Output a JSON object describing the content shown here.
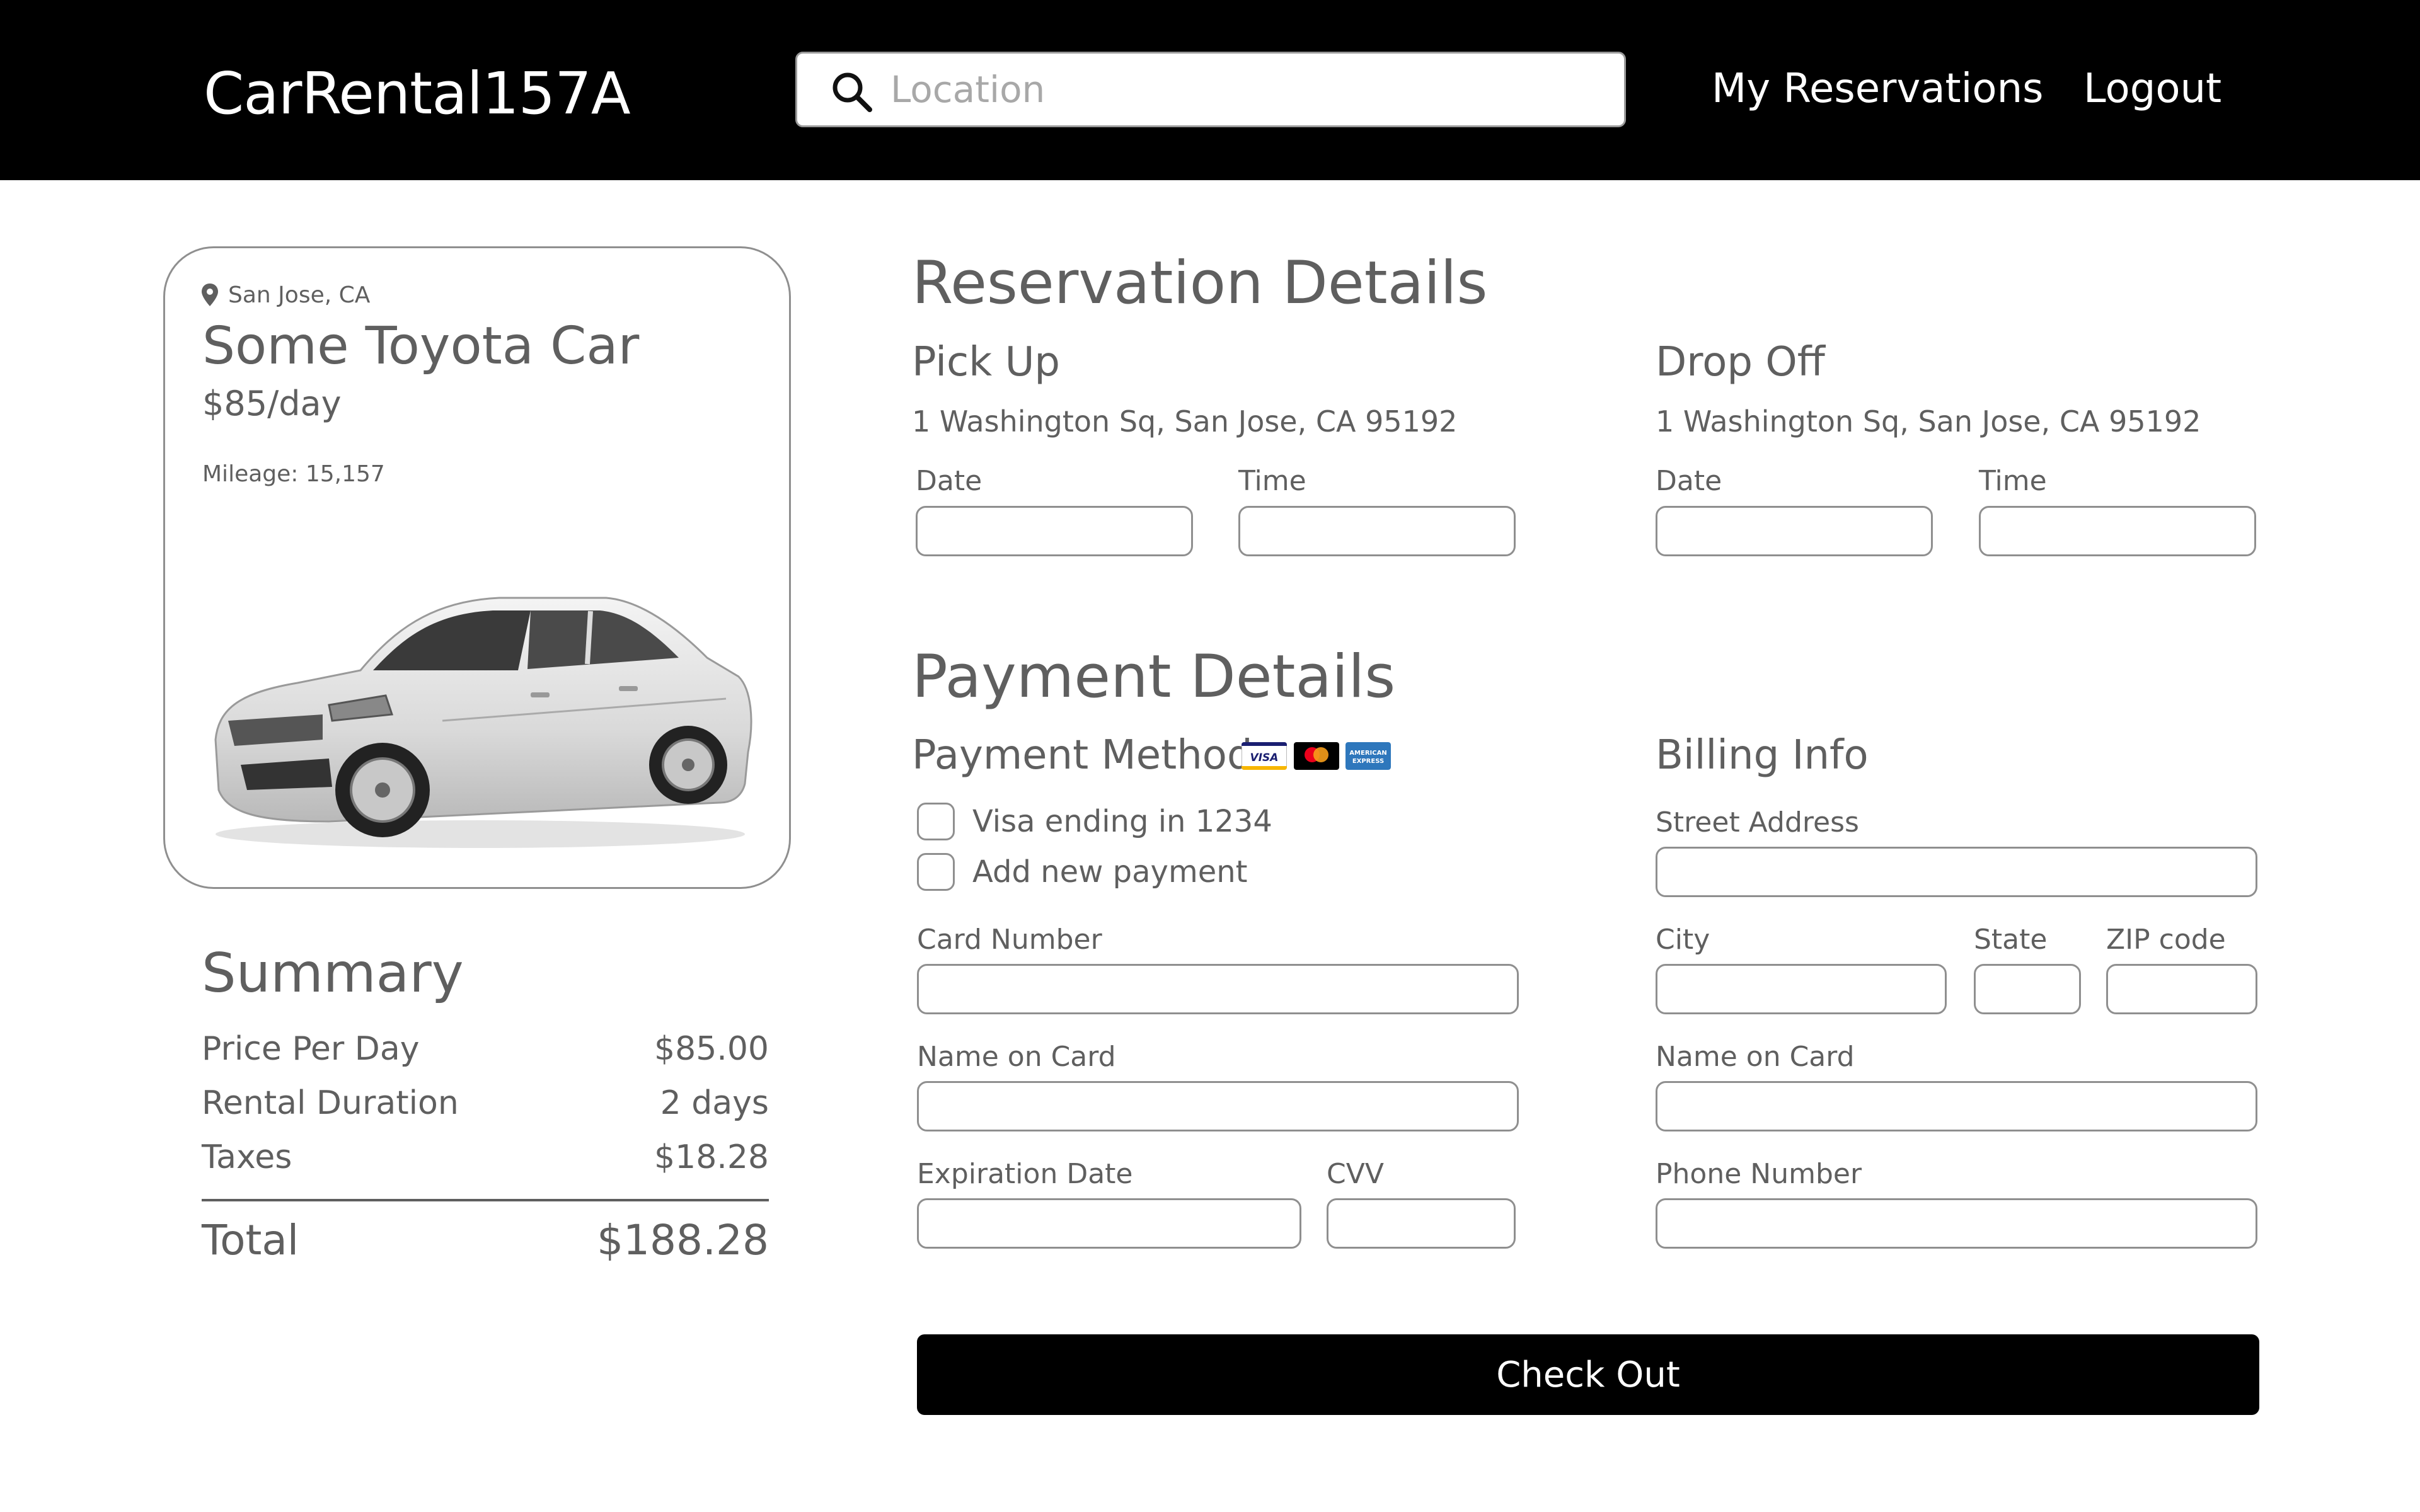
{
  "header": {
    "brand": "CarRental157A",
    "search_placeholder": "Location",
    "nav": {
      "reservations": "My Reservations",
      "logout": "Logout"
    }
  },
  "car": {
    "location": "San Jose, CA",
    "name": "Some Toyota Car",
    "price": "$85/day",
    "mileage": "Mileage: 15,157"
  },
  "summary": {
    "title": "Summary",
    "rows": [
      {
        "label": "Price Per Day",
        "value": "$85.00"
      },
      {
        "label": "Rental Duration",
        "value": "2 days"
      },
      {
        "label": "Taxes",
        "value": "$18.28"
      }
    ],
    "total_label": "Total",
    "total_value": "$188.28"
  },
  "reservation": {
    "title": "Reservation Details",
    "pickup": {
      "title": "Pick Up",
      "address": "1 Washington Sq,  San Jose, CA 95192",
      "date_label": "Date",
      "time_label": "Time"
    },
    "dropoff": {
      "title": "Drop Off",
      "address": "1 Washington Sq,  San Jose, CA 95192",
      "date_label": "Date",
      "time_label": "Time"
    }
  },
  "payment": {
    "title": "Payment Details",
    "method_title": "Payment Method",
    "card_brands": {
      "visa": "VISA",
      "amex_line1": "AMERICAN",
      "amex_line2": "EXPRESS"
    },
    "options": [
      "Visa ending in 1234",
      "Add new payment"
    ],
    "card_number_label": "Card Number",
    "name_label": "Name on Card",
    "expiration_label": "Expiration Date",
    "cvv_label": "CVV"
  },
  "billing": {
    "title": "Billing Info",
    "street_label": "Street Address",
    "city_label": "City",
    "state_label": "State",
    "zip_label": "ZIP code",
    "name_label": "Name on Card",
    "phone_label": "Phone Number"
  },
  "checkout_label": "Check Out",
  "colors": {
    "header_bg": "#000000",
    "text": "#5f5f5f",
    "border": "#8f8f8f",
    "button_bg": "#000000",
    "visa_blue": "#1a1f71",
    "mastercard_red": "#eb001b",
    "mastercard_orange": "#f79e1b",
    "amex_blue": "#2e77bc"
  }
}
